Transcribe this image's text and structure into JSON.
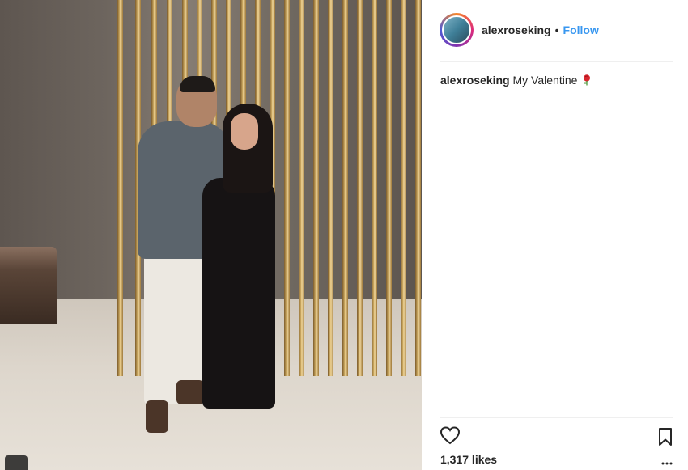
{
  "post": {
    "username": "alexroseking",
    "follow_label": "Follow",
    "separator": "•",
    "caption_user": "alexroseking",
    "caption_text": "My Valentine",
    "likes": "1,317 likes"
  },
  "icons": {
    "like": "heart-icon",
    "save": "bookmark-icon",
    "rose": "rose-emoji",
    "more": "more-options-icon"
  },
  "colors": {
    "follow": "#3897f0",
    "text": "#262626",
    "divider": "#efefef"
  }
}
